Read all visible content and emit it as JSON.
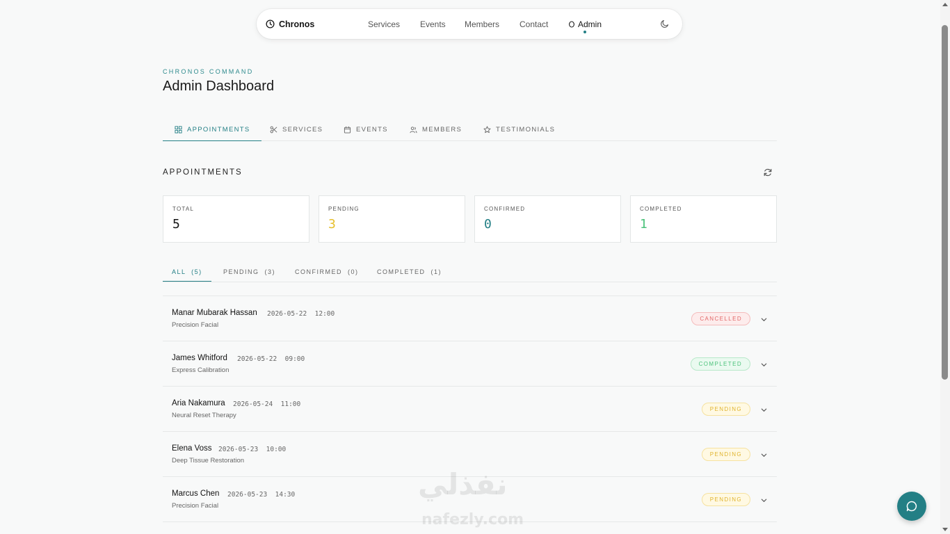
{
  "nav": {
    "brand": "Chronos",
    "links": [
      "Services",
      "Events",
      "Members",
      "Contact",
      "Admin"
    ],
    "active_link": "Admin"
  },
  "header": {
    "eyebrow": "CHRONOS COMMAND",
    "title": "Admin Dashboard"
  },
  "main_tabs": [
    {
      "label": "APPOINTMENTS",
      "icon": "grid-icon",
      "active": true
    },
    {
      "label": "SERVICES",
      "icon": "scissors-icon",
      "active": false
    },
    {
      "label": "EVENTS",
      "icon": "calendar-icon",
      "active": false
    },
    {
      "label": "MEMBERS",
      "icon": "users-icon",
      "active": false
    },
    {
      "label": "TESTIMONIALS",
      "icon": "star-icon",
      "active": false
    }
  ],
  "section": {
    "title": "APPOINTMENTS",
    "refresh_icon": "refresh-icon"
  },
  "stats": [
    {
      "label": "TOTAL",
      "value": "5",
      "color": "#151515"
    },
    {
      "label": "PENDING",
      "value": "3",
      "color": "#e6bf2c"
    },
    {
      "label": "CONFIRMED",
      "value": "0",
      "color": "#237f85"
    },
    {
      "label": "COMPLETED",
      "value": "1",
      "color": "#4cc27b"
    }
  ],
  "filters": [
    {
      "label": "ALL  (5)",
      "active": true
    },
    {
      "label": "PENDING  (3)",
      "active": false
    },
    {
      "label": "CONFIRMED  (0)",
      "active": false
    },
    {
      "label": "COMPLETED  (1)",
      "active": false
    }
  ],
  "appointments": [
    {
      "name": "Manar Mubarak Hassan",
      "datetime": "2026-05-22  12:00",
      "service": "Precision Facial",
      "status": "CANCELLED"
    },
    {
      "name": "James Whitford",
      "datetime": "2026-05-22  09:00",
      "service": "Express Calibration",
      "status": "COMPLETED"
    },
    {
      "name": "Aria Nakamura",
      "datetime": "2026-05-24  11:00",
      "service": "Neural Reset Therapy",
      "status": "PENDING"
    },
    {
      "name": "Elena Voss",
      "datetime": "2026-05-23  10:00",
      "service": "Deep Tissue Restoration",
      "status": "PENDING"
    },
    {
      "name": "Marcus Chen",
      "datetime": "2026-05-23  14:30",
      "service": "Precision Facial",
      "status": "PENDING"
    }
  ],
  "colors": {
    "accent": "#237f85",
    "background": "#f8f9f9"
  },
  "watermark": {
    "arabic": "نفذلي",
    "latin": "nafezly.com"
  }
}
